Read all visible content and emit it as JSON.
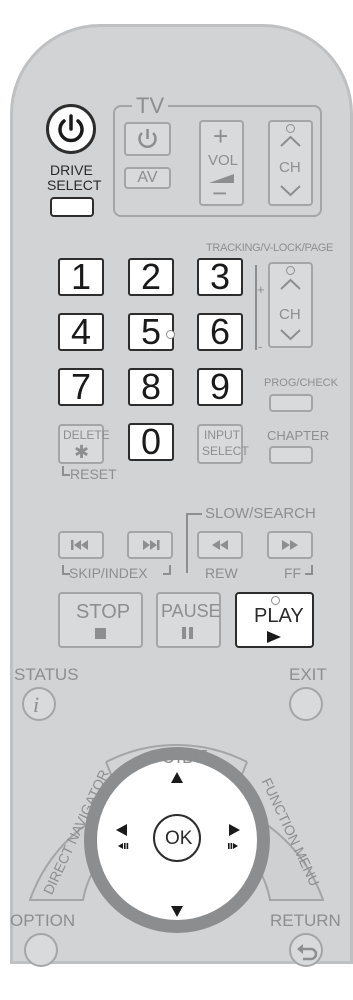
{
  "tv": {
    "title": "TV",
    "power_icon": "power-icon",
    "vol_label": "VOL",
    "ch_label": "CH",
    "av_label": "AV"
  },
  "drive_select": {
    "line1": "DRIVE",
    "line2": "SELECT"
  },
  "tracking_label": "TRACKING/V-LOCK/PAGE",
  "page_ch_label": "CH",
  "tracking_plus": "+",
  "tracking_minus": "-",
  "numbers": {
    "n1": "1",
    "n2": "2",
    "n3": "3",
    "n4": "4",
    "n5": "5",
    "n6": "6",
    "n7": "7",
    "n8": "8",
    "n9": "9",
    "n0": "0"
  },
  "prog_check": "PROG/CHECK",
  "delete": {
    "line1": "DELETE",
    "symbol": "✱"
  },
  "input_select": {
    "line1": "INPUT",
    "line2": "SELECT"
  },
  "chapter": "CHAPTER",
  "reset": "RESET",
  "slow_search": "SLOW/SEARCH",
  "skip_index": "SKIP/INDEX",
  "rew": "REW",
  "ff": "FF",
  "stop": "STOP",
  "pause": "PAUSE",
  "play": "PLAY",
  "status": "STATUS",
  "status_symbol": "i",
  "exit": "EXIT",
  "guide": "GUIDE",
  "direct_navigator": "DIRECT NAVIGATOR",
  "function_menu": "FUNCTION MENU",
  "ok": "OK",
  "option": "OPTION",
  "return": "RETURN",
  "colors": {
    "body": "#d2d3d4",
    "key_white": "#ffffff",
    "key_outline": "#2d2d2d",
    "label_gray": "#8d8e90",
    "ring": "#8c8d8f"
  }
}
